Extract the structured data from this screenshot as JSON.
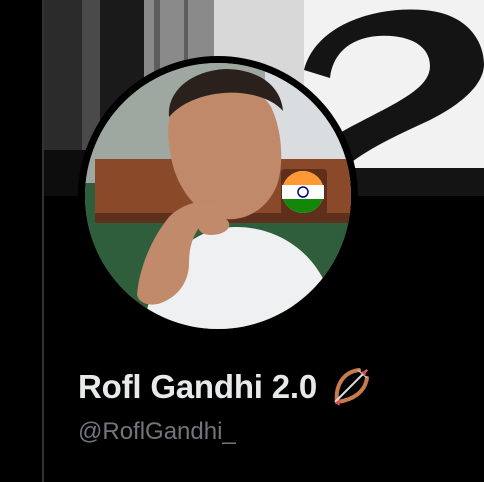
{
  "profile": {
    "display_name": "Rofl Gandhi 2.0",
    "handle": "@RoflGandhi_"
  },
  "icons": {
    "display_name_emoji": "bow-and-arrow-icon",
    "avatar_badge": "indian-flag-icon"
  },
  "colors": {
    "background": "#000000",
    "name_text": "#e7e9ea",
    "handle_text": "#71767b",
    "divider": "#2f3336"
  }
}
